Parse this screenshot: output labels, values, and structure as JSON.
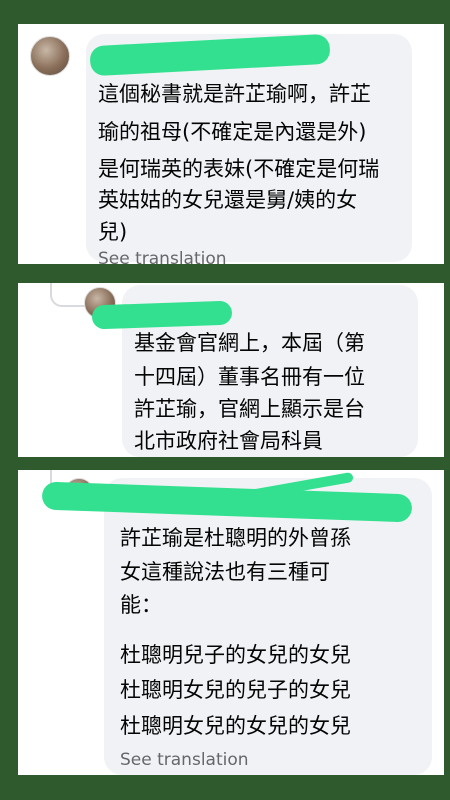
{
  "comments": [
    {
      "author": "",
      "lines": [
        "這個秘書就是許芷瑜啊，許芷",
        "瑜的祖母(不確定是內還是外)",
        "是何瑞英的表妹(不確定是何瑞",
        "英姑姑的女兒還是舅/姨的女",
        "兒)"
      ],
      "see_translation": "See translation"
    },
    {
      "author": "",
      "lines": [
        "基金會官網上，本屆（第",
        "十四屆）董事名冊有一位",
        "許芷瑜，官網上顯示是台",
        "北市政府社會局科員"
      ]
    },
    {
      "author": "",
      "lines": [
        "許芷瑜是杜聰明的外曾孫",
        "女這種說法也有三種可",
        "能：",
        "杜聰明兒子的女兒的女兒",
        "杜聰明女兒的兒子的女兒",
        "杜聰明女兒的女兒的女兒"
      ],
      "see_translation": "See translation"
    }
  ],
  "colors": {
    "background": "#2f5a2e",
    "bubble": "#f0f2f5",
    "redaction": "#33e08f",
    "secondary_text": "#65676b"
  }
}
